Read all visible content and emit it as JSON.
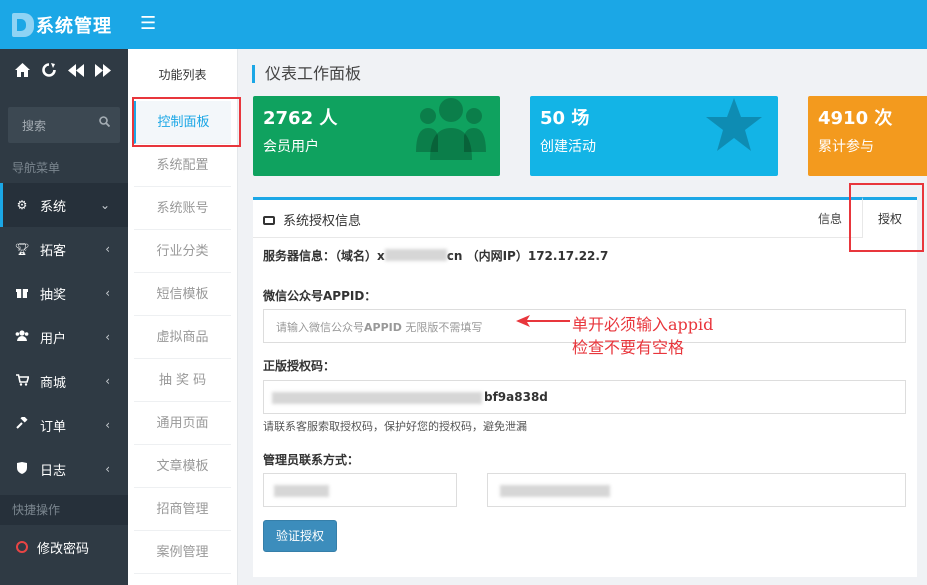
{
  "app": {
    "title": "系统管理"
  },
  "toolbar": {
    "menu_icon": "☰",
    "icons": [
      "home-icon",
      "refresh-icon",
      "backward-icon",
      "forward-icon"
    ]
  },
  "sidebar": {
    "search_placeholder": "搜索",
    "nav_section": "导航菜单",
    "items": [
      {
        "label": "系统",
        "icon": "gear-icon",
        "active": true
      },
      {
        "label": "拓客",
        "icon": "trophy-icon"
      },
      {
        "label": "抽奖",
        "icon": "gift-icon"
      },
      {
        "label": "用户",
        "icon": "users-icon"
      },
      {
        "label": "商城",
        "icon": "cart-icon"
      },
      {
        "label": "订单",
        "icon": "gavel-icon"
      },
      {
        "label": "日志",
        "icon": "shield-icon"
      }
    ],
    "quick_section": "快捷操作",
    "change_password": "修改密码"
  },
  "submenu": {
    "title": "功能列表",
    "items": [
      "控制面板",
      "系统配置",
      "系统账号",
      "行业分类",
      "短信模板",
      "虚拟商品",
      "抽 奖 码",
      "通用页面",
      "文章模板",
      "招商管理",
      "案例管理"
    ]
  },
  "main": {
    "title": "仪表工作面板",
    "cards": [
      {
        "value": "2762 人",
        "label": "会员用户",
        "icon": "users-icon",
        "color": "#0fa25f"
      },
      {
        "value": "50 场",
        "label": "创建活动",
        "icon": "star-icon",
        "color": "#13b4e6"
      },
      {
        "value": "4910 次",
        "label": "累计参与",
        "color": "#f39a1e"
      }
    ],
    "panel": {
      "title": "系统授权信息",
      "tab_info": "信息",
      "tab_auth": "授权",
      "server_prefix": "服务器信息：（域名）x",
      "server_suffix": "cn （内网IP）172.17.22.7",
      "appid_label": "微信公众号APPID：",
      "appid_placeholder_1": "请输入微信公众号",
      "appid_placeholder_2": "APPID",
      "appid_placeholder_3": " 无限版不需填写",
      "code_label": "正版授权码：",
      "code_value_tail": "bf9a838d",
      "code_hint": "请联系客服索取授权码，保护好您的授权码，避免泄漏",
      "admin_label": "管理员联系方式：",
      "verify_button": "验证授权"
    },
    "annotation": {
      "line1": "单开必须输入appid",
      "line2": "检查不要有空格"
    }
  }
}
